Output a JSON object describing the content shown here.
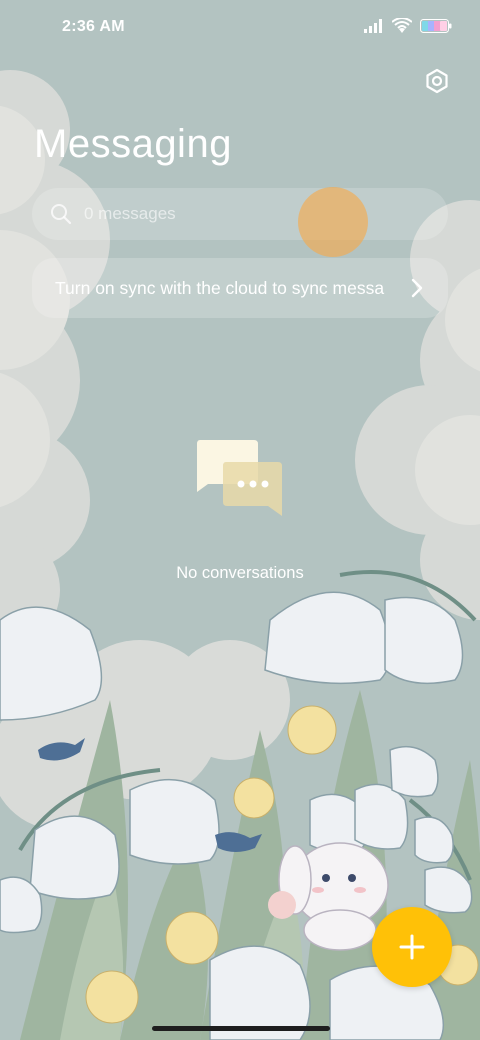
{
  "status_bar": {
    "time": "2:36 AM"
  },
  "header": {
    "title": "Messaging",
    "settings_icon": "gear-icon"
  },
  "search": {
    "placeholder": "0 messages",
    "icon": "search-icon"
  },
  "sync_banner": {
    "text": "Turn on sync with the cloud to sync messa",
    "icon": "chevron-right-icon"
  },
  "empty_state": {
    "icon": "chat-bubbles-icon",
    "text": "No conversations"
  },
  "fab": {
    "icon": "plus-icon",
    "color": "#ffc107"
  },
  "colors": {
    "accent": "#ffc107",
    "sky": "#b4c4c2"
  }
}
